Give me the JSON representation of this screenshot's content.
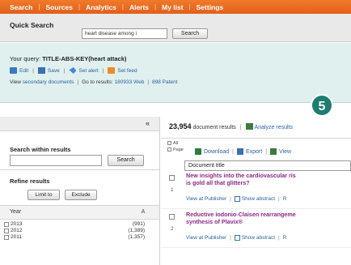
{
  "topnav": {
    "items": [
      "Search",
      "Sources",
      "Analytics",
      "Alerts",
      "My list",
      "Settings"
    ]
  },
  "quick_search": {
    "title": "Quick Search",
    "input_value": "heart disease among i",
    "button_label": "Search"
  },
  "query": {
    "prefix": "Your query:",
    "text": "TITLE-ABS-KEY(heart attack)",
    "actions": [
      "Edit",
      "Save",
      "Set alert",
      "Set feed"
    ],
    "view_prefix": "View",
    "secondary_link": "secondary documents",
    "goto_prefix": "Go to results:",
    "web_link": "180933 Web",
    "patent_link": "898 Patent"
  },
  "badge": "5",
  "sidebar": {
    "collapse_icon": "«",
    "search_title": "Search within results",
    "search_button": "Search",
    "refine_title": "Refine results",
    "limit_button": "Limit to",
    "exclude_button": "Exclude",
    "year_label": "Year",
    "year_toggle": "A",
    "years": [
      {
        "year": "2013",
        "count": "(991)"
      },
      {
        "year": "2012",
        "count": "(1,389)"
      },
      {
        "year": "2011",
        "count": "(1,357)"
      }
    ]
  },
  "results": {
    "count": "23,954",
    "count_suffix": "document results",
    "analyze_label": "Analyze results",
    "all_label": "All",
    "page_label": "Page",
    "tools": [
      "Download",
      "Export",
      "View"
    ],
    "column_header": "Document title",
    "items": [
      {
        "num": "1",
        "title_line1": "New insights into the cardiovascular ris",
        "title_line2": "is gold all that glitters?",
        "pubmed_link": "View at Publisher",
        "abstract_link": "Show abstract",
        "extra": "R"
      },
      {
        "num": "2",
        "title_line1": "Reductive iodonio-Claisen rearrangeme",
        "title_line2": "synthesis of Plavix®",
        "pubmed_link": "View at Publisher",
        "abstract_link": "Show abstract",
        "extra": "R"
      }
    ]
  },
  "colors": {
    "nav_orange": "#e8681f",
    "query_bg": "#dff0ef",
    "badge": "#1c7d70",
    "title_purple": "#8a2a86",
    "link_blue": "#2a5f9e"
  }
}
